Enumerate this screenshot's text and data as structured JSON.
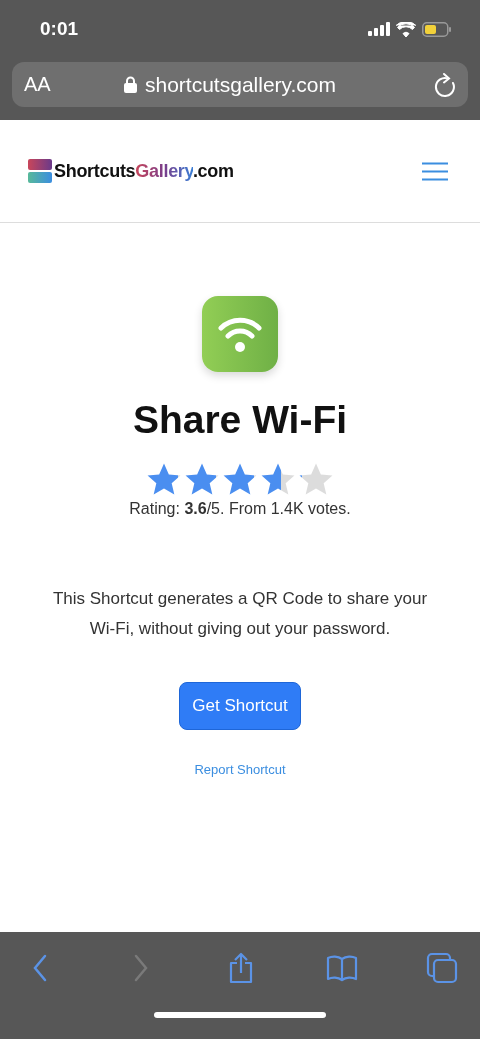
{
  "status_bar": {
    "time": "0:01"
  },
  "address_bar": {
    "text_size_label": "AA",
    "url": "shortcutsgallery.com"
  },
  "site_header": {
    "logo_parts": [
      {
        "text": "Shortcuts",
        "kind": "plain"
      },
      {
        "text": "Gallery",
        "kind": "accent"
      },
      {
        "text": ".com",
        "kind": "plain"
      }
    ]
  },
  "shortcut": {
    "title": "Share Wi-Fi",
    "stars": 3.6,
    "rating_text": "Rating: **3.6**/5. From 1.4K votes.",
    "description": "This Shortcut generates a QR Code to share your Wi-Fi, without giving out your password.",
    "get_button": "Get Shortcut",
    "report_link": "Report Shortcut"
  },
  "toolbar": [
    {
      "kind": "back",
      "disabled": false
    },
    {
      "kind": "forward",
      "disabled": true
    },
    {
      "kind": "share",
      "disabled": false
    },
    {
      "kind": "bookmarks",
      "disabled": false
    },
    {
      "kind": "tabs",
      "disabled": false
    }
  ]
}
